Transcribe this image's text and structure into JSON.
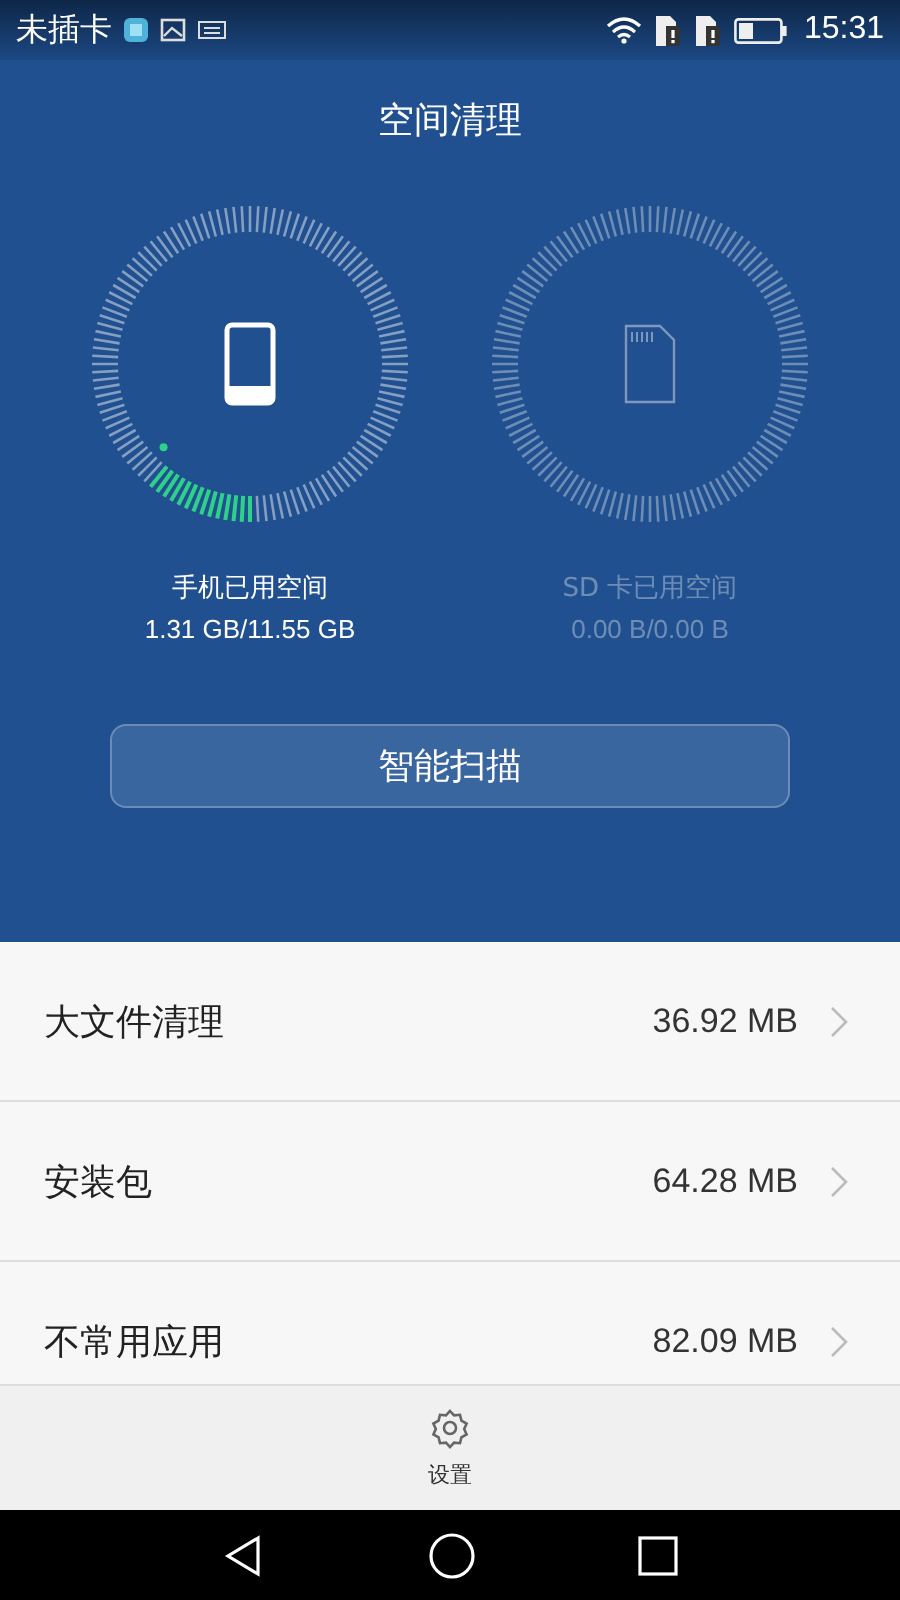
{
  "status_bar": {
    "carrier": "未插卡",
    "time": "15:31"
  },
  "title": "空间清理",
  "storages": [
    {
      "kind": "phone",
      "label": "手机已用空间",
      "usage": "1.31 GB/11.55 GB",
      "disabled": false
    },
    {
      "kind": "sd",
      "label": "SD 卡已用空间",
      "usage": "0.00 B/0.00 B",
      "disabled": true
    }
  ],
  "scan_button": "智能扫描",
  "items": [
    {
      "label": "大文件清理",
      "size": "36.92 MB"
    },
    {
      "label": "安装包",
      "size": "64.28 MB"
    },
    {
      "label": "不常用应用",
      "size": "82.09 MB"
    }
  ],
  "bottom_bar": {
    "label": "设置"
  }
}
